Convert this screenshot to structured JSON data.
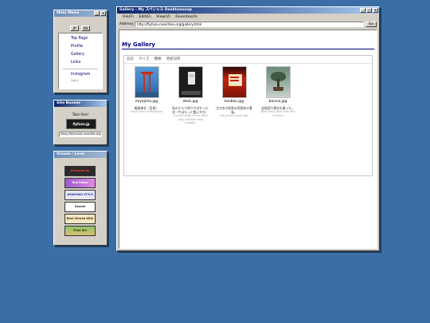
{
  "main_menu": {
    "title": "Main Menu",
    "lang_buttons": [
      "JP",
      "EN"
    ],
    "items": [
      "Top Page",
      "Profile",
      "Gallery",
      "Links"
    ],
    "instagram": "Instagram",
    "instagram_sub": "Daily"
  },
  "site_banner": {
    "title": "Site Banner",
    "take_free": "Take free!",
    "banner_text": "fiyfuzu.jp",
    "url": "https://fiyfuzuzip.neocities.org/"
  },
  "unions": {
    "title": "Unions / Love",
    "badges": [
      "Designed by Macintosh",
      "Text Editor",
      "WINDOWS STYLE 1999",
      "Doodle",
      "Best Viewed With Eyes",
      "Pixel Art"
    ]
  },
  "browser": {
    "title": "Gallery - My スペシャル Desktooooop",
    "menu": [
      "File(F)",
      "Edit(E)",
      "View(V)",
      "Favorites(A)"
    ],
    "address_label": "Address:",
    "address": "http://fiyfuzu.neocities.org/gallery.html",
    "go": "Go"
  },
  "gallery": {
    "title": "My Gallery",
    "columns": [
      "名前",
      "サイズ",
      "種類",
      "更新日時"
    ],
    "items": [
      {
        "file": "miyajima.jpg",
        "caption_jp": "厳島神社（宮島）",
        "caption_en": "Iconic torii of Miyajima"
      },
      {
        "file": "desk.jpg",
        "caption_jp": "私のデスク周りやばかった笑（今はもっと酷いかも）",
        "caption_en": "Current state of my desk (way messier now maybe)"
      },
      {
        "file": "kanban.jpg",
        "caption_jp": "古き良き昭和な雰囲気の看板。",
        "caption_en": "Old-school shop sign"
      },
      {
        "file": "bonsai.jpg",
        "caption_jp": "盆栽園で黒松を買った。",
        "caption_en": "New black pine from the nursery"
      }
    ]
  },
  "colors": {
    "desktop": "#3a6ea5",
    "title_active": "#0a246a",
    "link": "#000080"
  }
}
